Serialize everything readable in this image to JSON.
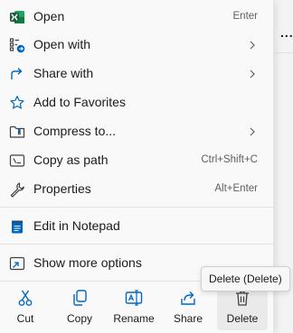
{
  "menu": {
    "items": [
      {
        "label": "Open",
        "shortcut": "Enter",
        "icon": "excel-icon"
      },
      {
        "label": "Open with",
        "icon": "open-with-icon",
        "submenu": true
      },
      {
        "label": "Share with",
        "icon": "share-icon",
        "submenu": true
      },
      {
        "label": "Add to Favorites",
        "icon": "star-icon"
      },
      {
        "label": "Compress to...",
        "icon": "zip-folder-icon",
        "submenu": true
      },
      {
        "label": "Copy as path",
        "shortcut": "Ctrl+Shift+C",
        "icon": "path-icon"
      },
      {
        "label": "Properties",
        "shortcut": "Alt+Enter",
        "icon": "wrench-icon"
      },
      {
        "label": "Edit in Notepad",
        "icon": "notepad-icon"
      },
      {
        "label": "Show more options",
        "icon": "more-options-icon"
      }
    ],
    "actions": [
      {
        "label": "Cut",
        "icon": "scissors-icon"
      },
      {
        "label": "Copy",
        "icon": "copy-icon"
      },
      {
        "label": "Rename",
        "icon": "rename-icon"
      },
      {
        "label": "Share",
        "icon": "share-icon"
      },
      {
        "label": "Delete",
        "icon": "trash-icon"
      }
    ],
    "tooltip": "Delete (Delete)"
  },
  "background": {
    "dots": "..."
  },
  "colors": {
    "excel_green": "#1d6f42",
    "accent_blue": "#0067c0",
    "icon_gray": "#404040"
  }
}
